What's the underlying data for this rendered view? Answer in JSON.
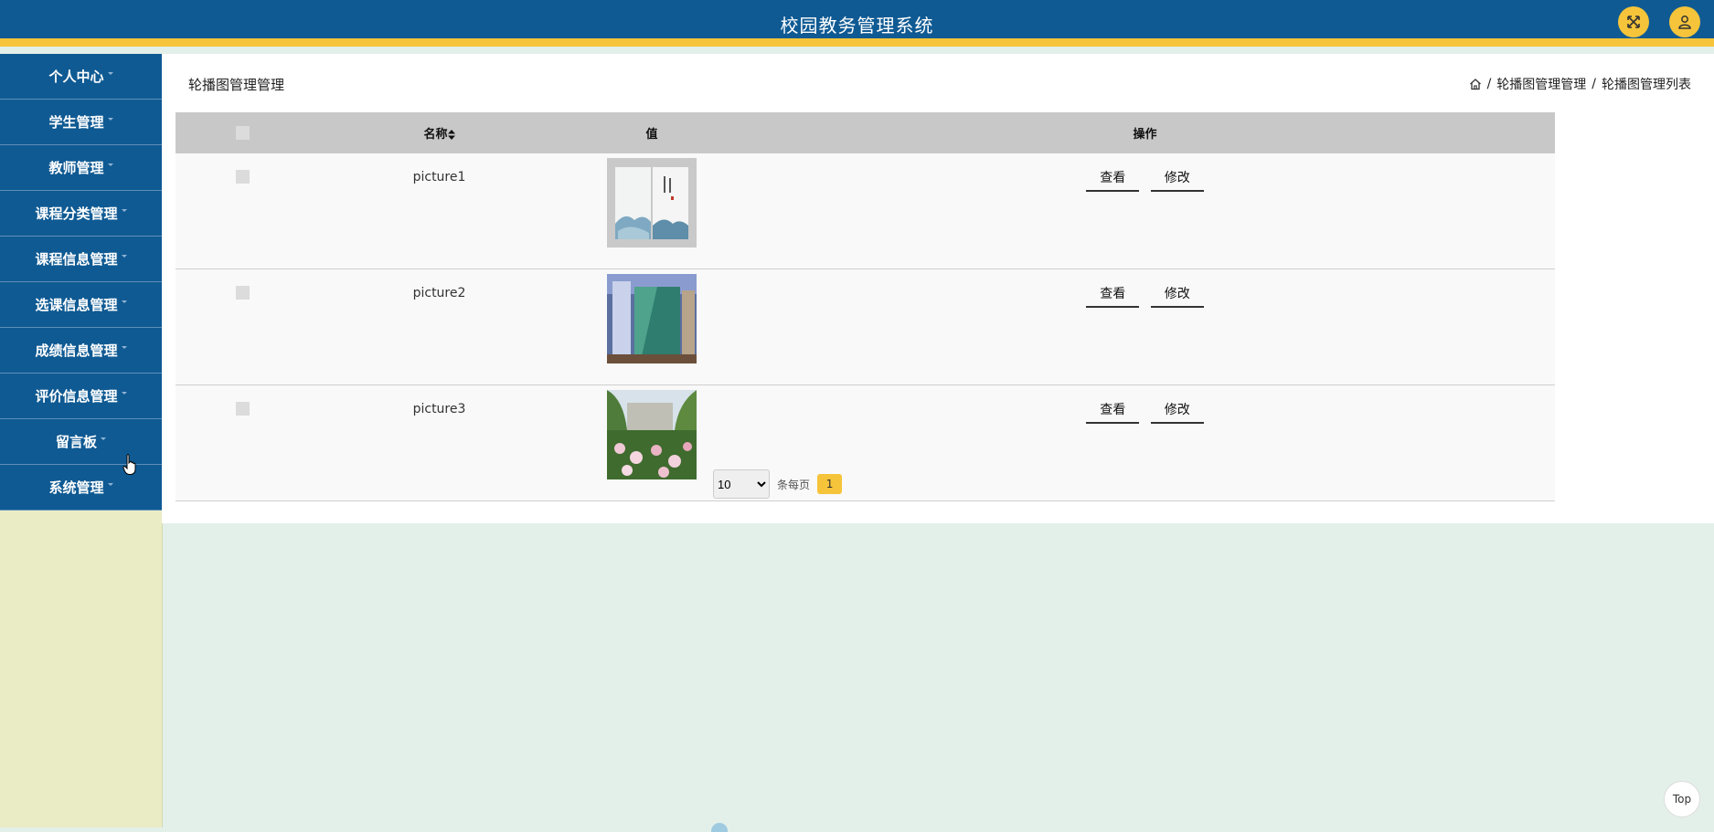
{
  "header": {
    "title": "校园教务管理系统",
    "fullscreen_icon": "expand-icon",
    "user_icon": "user-icon"
  },
  "sidebar": {
    "items": [
      {
        "label": "个人中心"
      },
      {
        "label": "学生管理"
      },
      {
        "label": "教师管理"
      },
      {
        "label": "课程分类管理"
      },
      {
        "label": "课程信息管理"
      },
      {
        "label": "选课信息管理"
      },
      {
        "label": "成绩信息管理"
      },
      {
        "label": "评价信息管理"
      },
      {
        "label": "留言板"
      },
      {
        "label": "系统管理"
      }
    ]
  },
  "page": {
    "heading": "轮播图管理管理",
    "breadcrumb": {
      "sep1": "/",
      "level1": "轮播图管理管理",
      "sep2": "/",
      "level2": "轮播图管理列表"
    }
  },
  "table": {
    "headers": {
      "name": "名称",
      "value": "值",
      "actions": "操作"
    },
    "rows": [
      {
        "name": "picture1",
        "view": "查看",
        "edit": "修改"
      },
      {
        "name": "picture2",
        "view": "查看",
        "edit": "修改"
      },
      {
        "name": "picture3",
        "view": "查看",
        "edit": "修改"
      }
    ]
  },
  "pagination": {
    "page_size": "10",
    "per_page_label": "条每页",
    "current_page": "1"
  },
  "top_button": "Top",
  "colors": {
    "primary": "#0f5a93",
    "accent": "#f5c43a",
    "sidebar_bg": "#e9ecc5",
    "page_bg": "#e3f0e9"
  }
}
